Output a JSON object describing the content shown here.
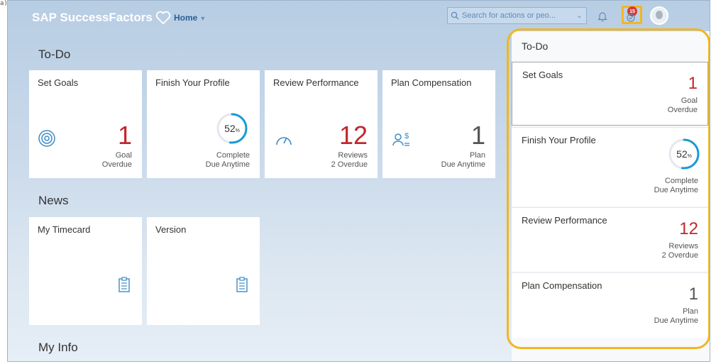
{
  "corner_label": "a)",
  "header": {
    "brand": "SAP SuccessFactors",
    "home_label": "Home",
    "search_placeholder": "Search for actions or peo...",
    "notification_count": "15"
  },
  "sections": {
    "todo": "To-Do",
    "news": "News",
    "myinfo": "My Info"
  },
  "todo_tiles": [
    {
      "title": "Set Goals",
      "value": "1",
      "line1": "Goal",
      "line2": "Overdue"
    },
    {
      "title": "Finish Your Profile",
      "value": "52",
      "unit": "%",
      "line1": "Complete",
      "line2": "Due Anytime"
    },
    {
      "title": "Review Performance",
      "value": "12",
      "line1": "Reviews",
      "line2": "2 Overdue"
    },
    {
      "title": "Plan Compensation",
      "value": "1",
      "line1": "Plan",
      "line2": "Due Anytime"
    }
  ],
  "profile_progress": 0.52,
  "news_tiles": [
    {
      "title": "My Timecard"
    },
    {
      "title": "Version"
    }
  ],
  "panel": {
    "title": "To-Do",
    "items": [
      {
        "title": "Set Goals",
        "value": "1",
        "line1": "Goal",
        "line2": "Overdue"
      },
      {
        "title": "Finish Your Profile",
        "value": "52",
        "unit": "%",
        "line1": "Complete",
        "line2": "Due Anytime"
      },
      {
        "title": "Review Performance",
        "value": "12",
        "line1": "Reviews",
        "line2": "2 Overdue"
      },
      {
        "title": "Plan Compensation",
        "value": "1",
        "line1": "Plan",
        "line2": "Due Anytime"
      }
    ]
  },
  "colors": {
    "overdue": "#c0272d",
    "accent": "#1a9ad6",
    "highlight": "#f3b620"
  }
}
